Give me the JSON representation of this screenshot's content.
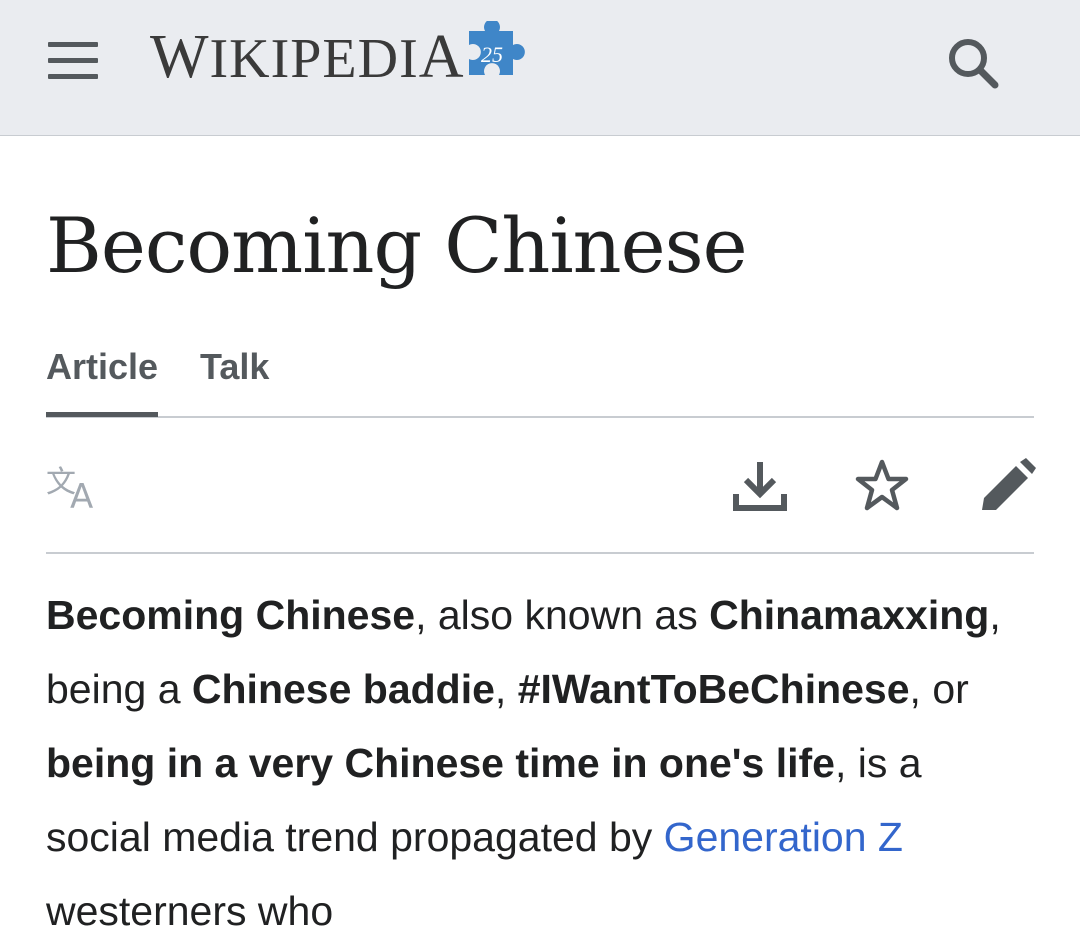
{
  "header": {
    "logo_text_first": "W",
    "logo_text_mid": "IKIPEDI",
    "logo_text_last": "A",
    "logo_badge": "25",
    "menu_icon": "menu-icon",
    "search_icon": "search-icon",
    "background": "#eaecf0"
  },
  "page": {
    "title": "Becoming Chinese"
  },
  "tabs": [
    {
      "label": "Article",
      "active": true
    },
    {
      "label": "Talk",
      "active": false
    }
  ],
  "toolbar": {
    "language_icon": "language-icon",
    "download_icon": "download-icon",
    "watch_icon": "star-icon",
    "edit_icon": "pencil-icon"
  },
  "content": {
    "p1_b1": "Becoming Chinese",
    "p1_t1": ", also known as ",
    "p1_b2": "Chinamaxxing",
    "p1_t2": ", being a ",
    "p1_b3": "Chinese baddie",
    "p1_t3": ", ",
    "p1_b4": "#IWantToBeChinese",
    "p1_t4": ", or ",
    "p1_b5": "being in a very Chinese time in one's life",
    "p1_t5": ", is a social media trend propagated by ",
    "p1_link1": "Generation Z",
    "p1_t6": " westerners who"
  },
  "colors": {
    "link": "#3366cc",
    "text": "#202122",
    "icon": "#54595d",
    "puzzle": "#3f86c8"
  }
}
